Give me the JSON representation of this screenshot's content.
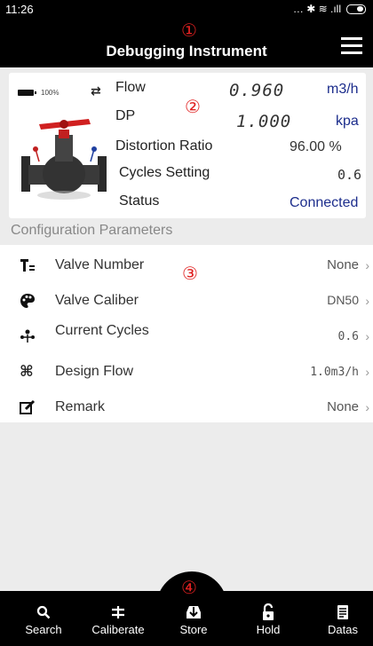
{
  "statusbar": {
    "time": "11:26",
    "icons": "… ✱ ≋ .ıll"
  },
  "header": {
    "marker": "①",
    "title": "Debugging Instrument"
  },
  "device": {
    "battery_percent": "100%",
    "marker": "②",
    "flow_label": "Flow",
    "flow_value": "0.960",
    "flow_unit": "m3/h",
    "dp_label": "DP",
    "dp_value": "1.000",
    "dp_unit": "kpa",
    "distortion_label": "Distortion Ratio",
    "distortion_value": "96.00 %",
    "cycles_label": "Cycles Setting",
    "cycles_value": "0.6",
    "status_label": "Status",
    "status_value": "Connected"
  },
  "config": {
    "section_title": "Configuration Parameters",
    "marker": "③",
    "rows": [
      {
        "label": "Valve Number",
        "value": "None",
        "chevron": "›"
      },
      {
        "label": "Valve Caliber",
        "value": "DN50",
        "chevron": "›"
      },
      {
        "label": "Current Cycles",
        "value": "0.6",
        "chevron": "›"
      },
      {
        "label": "Design Flow",
        "value": "1.0m3/h",
        "chevron": "›"
      },
      {
        "label": "Remark",
        "value": "None",
        "chevron": "›"
      }
    ]
  },
  "tabbar": {
    "marker": "④",
    "tabs": [
      {
        "label": "Search",
        "icon": "search-icon"
      },
      {
        "label": "Caliberate",
        "icon": "calibrate-icon"
      },
      {
        "label": "Store",
        "icon": "store-icon"
      },
      {
        "label": "Hold",
        "icon": "lock-icon"
      },
      {
        "label": "Datas",
        "icon": "document-icon"
      }
    ]
  }
}
